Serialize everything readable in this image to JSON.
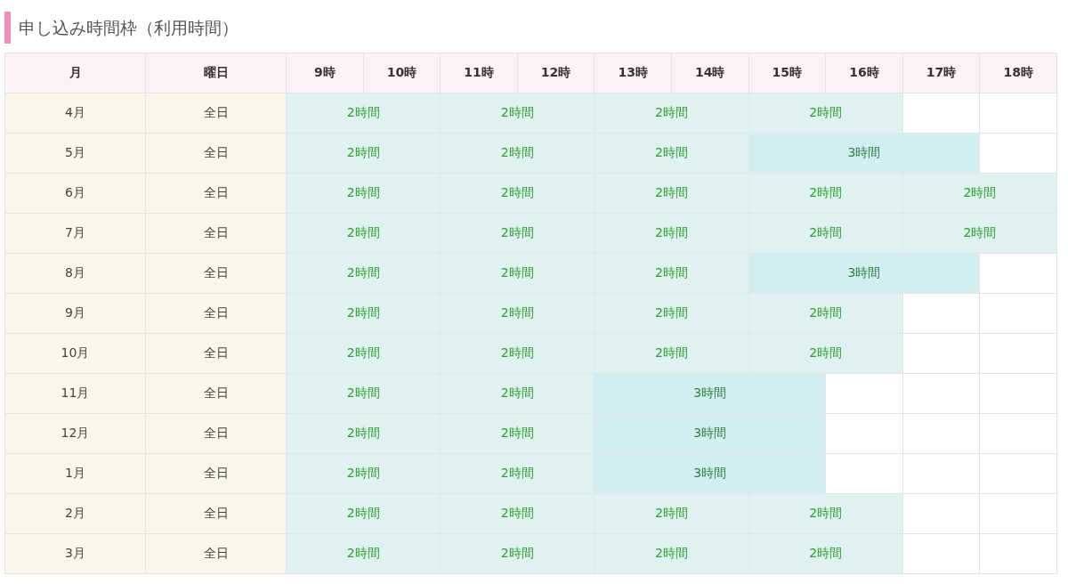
{
  "heading": "申し込み時間枠（利用時間）",
  "table": {
    "columns": [
      "月",
      "曜日",
      "9時",
      "10時",
      "11時",
      "12時",
      "13時",
      "14時",
      "15時",
      "16時",
      "17時",
      "18時"
    ],
    "rows": [
      {
        "month": "4月",
        "day": "全日",
        "slots": [
          {
            "kind": "two_hour",
            "label": "2時間"
          },
          {
            "kind": "two_hour",
            "label": "2時間"
          },
          {
            "kind": "two_hour",
            "label": "2時間"
          },
          {
            "kind": "two_hour",
            "label": "2時間"
          },
          {
            "kind": "empty"
          },
          {
            "kind": "empty"
          }
        ]
      },
      {
        "month": "5月",
        "day": "全日",
        "slots": [
          {
            "kind": "two_hour",
            "label": "2時間"
          },
          {
            "kind": "two_hour",
            "label": "2時間"
          },
          {
            "kind": "two_hour",
            "label": "2時間"
          },
          {
            "kind": "three_hour",
            "label": "3時間"
          },
          {
            "kind": "empty"
          }
        ]
      },
      {
        "month": "6月",
        "day": "全日",
        "slots": [
          {
            "kind": "two_hour",
            "label": "2時間"
          },
          {
            "kind": "two_hour",
            "label": "2時間"
          },
          {
            "kind": "two_hour",
            "label": "2時間"
          },
          {
            "kind": "two_hour",
            "label": "2時間"
          },
          {
            "kind": "two_hour",
            "label": "2時間"
          }
        ]
      },
      {
        "month": "7月",
        "day": "全日",
        "slots": [
          {
            "kind": "two_hour",
            "label": "2時間"
          },
          {
            "kind": "two_hour",
            "label": "2時間"
          },
          {
            "kind": "two_hour",
            "label": "2時間"
          },
          {
            "kind": "two_hour",
            "label": "2時間"
          },
          {
            "kind": "two_hour",
            "label": "2時間"
          }
        ]
      },
      {
        "month": "8月",
        "day": "全日",
        "slots": [
          {
            "kind": "two_hour",
            "label": "2時間"
          },
          {
            "kind": "two_hour",
            "label": "2時間"
          },
          {
            "kind": "two_hour",
            "label": "2時間"
          },
          {
            "kind": "three_hour",
            "label": "3時間"
          },
          {
            "kind": "empty"
          }
        ]
      },
      {
        "month": "9月",
        "day": "全日",
        "slots": [
          {
            "kind": "two_hour",
            "label": "2時間"
          },
          {
            "kind": "two_hour",
            "label": "2時間"
          },
          {
            "kind": "two_hour",
            "label": "2時間"
          },
          {
            "kind": "two_hour",
            "label": "2時間"
          },
          {
            "kind": "empty"
          },
          {
            "kind": "empty"
          }
        ]
      },
      {
        "month": "10月",
        "day": "全日",
        "slots": [
          {
            "kind": "two_hour",
            "label": "2時間"
          },
          {
            "kind": "two_hour",
            "label": "2時間"
          },
          {
            "kind": "two_hour",
            "label": "2時間"
          },
          {
            "kind": "two_hour",
            "label": "2時間"
          },
          {
            "kind": "empty"
          },
          {
            "kind": "empty"
          }
        ]
      },
      {
        "month": "11月",
        "day": "全日",
        "slots": [
          {
            "kind": "two_hour",
            "label": "2時間"
          },
          {
            "kind": "two_hour",
            "label": "2時間"
          },
          {
            "kind": "three_hour",
            "label": "3時間"
          },
          {
            "kind": "empty"
          },
          {
            "kind": "empty"
          },
          {
            "kind": "empty"
          }
        ]
      },
      {
        "month": "12月",
        "day": "全日",
        "slots": [
          {
            "kind": "two_hour",
            "label": "2時間"
          },
          {
            "kind": "two_hour",
            "label": "2時間"
          },
          {
            "kind": "three_hour",
            "label": "3時間"
          },
          {
            "kind": "empty"
          },
          {
            "kind": "empty"
          },
          {
            "kind": "empty"
          }
        ]
      },
      {
        "month": "1月",
        "day": "全日",
        "slots": [
          {
            "kind": "two_hour",
            "label": "2時間"
          },
          {
            "kind": "two_hour",
            "label": "2時間"
          },
          {
            "kind": "three_hour",
            "label": "3時間"
          },
          {
            "kind": "empty"
          },
          {
            "kind": "empty"
          },
          {
            "kind": "empty"
          }
        ]
      },
      {
        "month": "2月",
        "day": "全日",
        "slots": [
          {
            "kind": "two_hour",
            "label": "2時間"
          },
          {
            "kind": "two_hour",
            "label": "2時間"
          },
          {
            "kind": "two_hour",
            "label": "2時間"
          },
          {
            "kind": "two_hour",
            "label": "2時間"
          },
          {
            "kind": "empty"
          },
          {
            "kind": "empty"
          }
        ]
      },
      {
        "month": "3月",
        "day": "全日",
        "slots": [
          {
            "kind": "two_hour",
            "label": "2時間"
          },
          {
            "kind": "two_hour",
            "label": "2時間"
          },
          {
            "kind": "two_hour",
            "label": "2時間"
          },
          {
            "kind": "two_hour",
            "label": "2時間"
          },
          {
            "kind": "empty"
          },
          {
            "kind": "empty"
          }
        ]
      }
    ]
  }
}
